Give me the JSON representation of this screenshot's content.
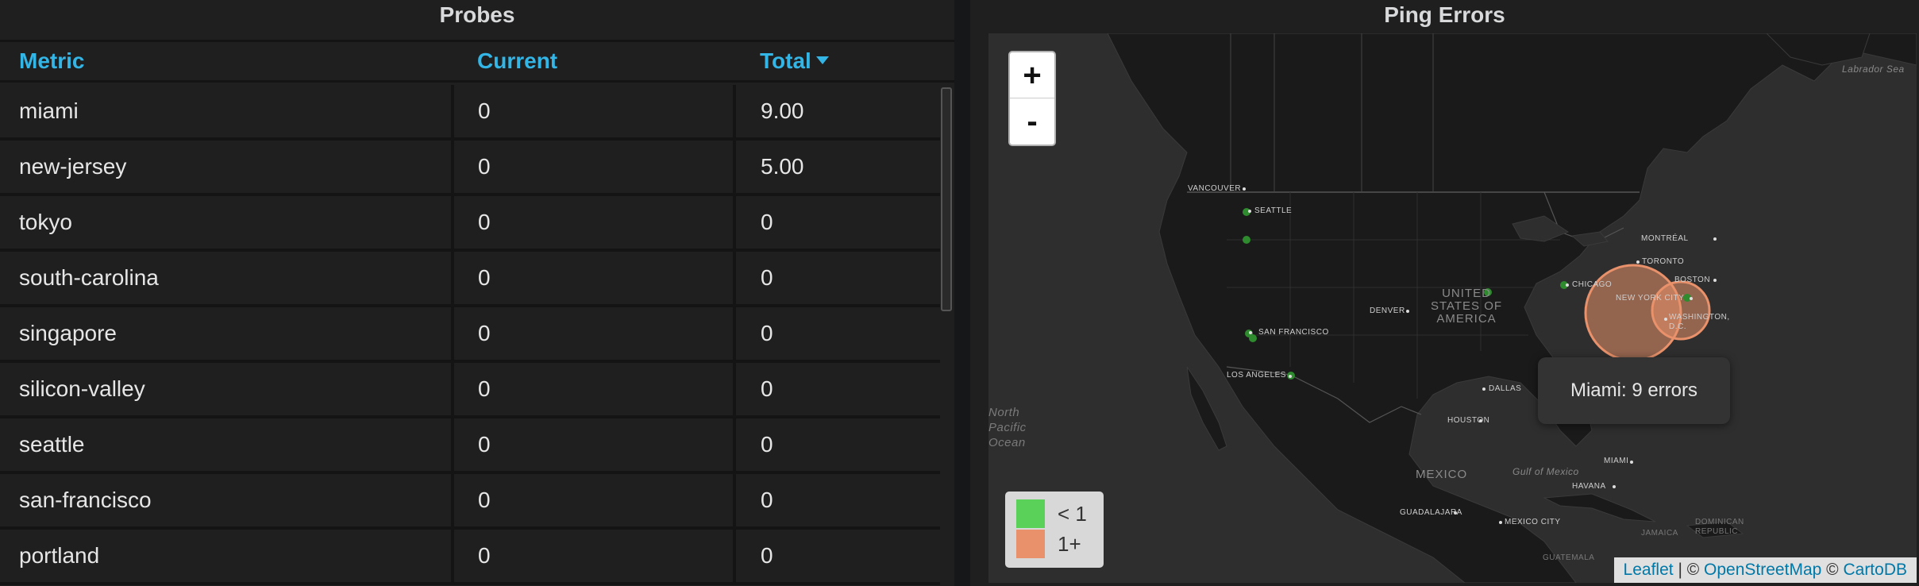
{
  "probes_panel": {
    "title": "Probes",
    "columns": {
      "metric": "Metric",
      "current": "Current",
      "total": "Total"
    },
    "rows": [
      {
        "metric": "miami",
        "current": "0",
        "total": "9.00"
      },
      {
        "metric": "new-jersey",
        "current": "0",
        "total": "5.00"
      },
      {
        "metric": "tokyo",
        "current": "0",
        "total": "0"
      },
      {
        "metric": "south-carolina",
        "current": "0",
        "total": "0"
      },
      {
        "metric": "singapore",
        "current": "0",
        "total": "0"
      },
      {
        "metric": "silicon-valley",
        "current": "0",
        "total": "0"
      },
      {
        "metric": "seattle",
        "current": "0",
        "total": "0"
      },
      {
        "metric": "san-francisco",
        "current": "0",
        "total": "0"
      },
      {
        "metric": "portland",
        "current": "0",
        "total": "0"
      }
    ]
  },
  "map_panel": {
    "title": "Ping Errors",
    "zoom_in": "+",
    "zoom_out": "-",
    "tooltip": "Miami: 9 errors",
    "legend": [
      {
        "label": "< 1",
        "color": "#5ad25a"
      },
      {
        "label": "1+",
        "color": "#e8916a"
      }
    ],
    "attribution": {
      "leaflet": "Leaflet",
      "separator": " | © ",
      "osm": "OpenStreetMap",
      "copy": " © ",
      "carto": "CartoDB"
    },
    "labels": {
      "vancouver": "VANCOUVER",
      "seattle": "SEATTLE",
      "san_francisco": "SAN FRANCISCO",
      "los_angeles": "LOS ANGELES",
      "denver": "DENVER",
      "dallas": "DALLAS",
      "houston": "HOUSTON",
      "chicago": "CHICAGO",
      "montreal": "MONTRÉAL",
      "toronto": "TORONTO",
      "boston": "BOSTON",
      "new_york": "NEW YORK CITY",
      "washington": "WASHINGTON, D.C.",
      "miami": "MIAMI",
      "havana": "HAVANA",
      "guadalajara": "GUADALAJARA",
      "mexico_city": "MEXICO CITY",
      "guatemala": "GUATEMALA",
      "jamaica": "JAMAICA",
      "dominican": "DOMINICAN REPUBLIC",
      "usa": "UNITED STATES OF AMERICA",
      "mexico": "MEXICO",
      "gulf": "Gulf of Mexico",
      "pacific": "North Pacific Ocean",
      "labrador": "Labrador Sea"
    },
    "colors": {
      "ok": "#5ad25a",
      "error": "#e8916a",
      "land": "#1a1a1a",
      "water": "#2e2e2e"
    }
  }
}
